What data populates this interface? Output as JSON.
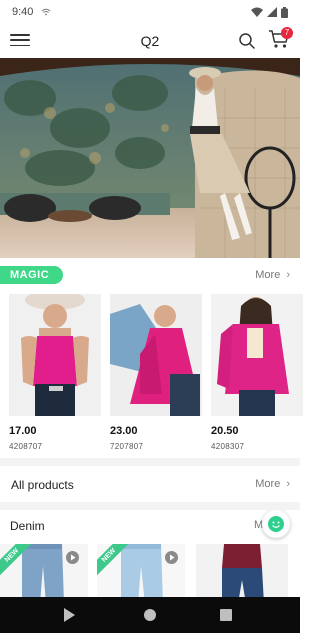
{
  "status_bar": {
    "time": "9:40"
  },
  "header": {
    "title": "Q2",
    "cart_count": "7"
  },
  "magic": {
    "tag": "MAGIC",
    "more_label": "More",
    "products": [
      {
        "price": "17.00",
        "code": "4208707"
      },
      {
        "price": "23.00",
        "code": "7207807"
      },
      {
        "price": "20.50",
        "code": "4208307"
      }
    ]
  },
  "all_products": {
    "label": "All products",
    "more_label": "More"
  },
  "denim": {
    "title": "Denim",
    "more_label": "M",
    "badge": "NEW"
  },
  "colors": {
    "accent_green": "#3fd889",
    "badge_red": "#e8263c",
    "nav_bar": "#0b0b0b"
  }
}
